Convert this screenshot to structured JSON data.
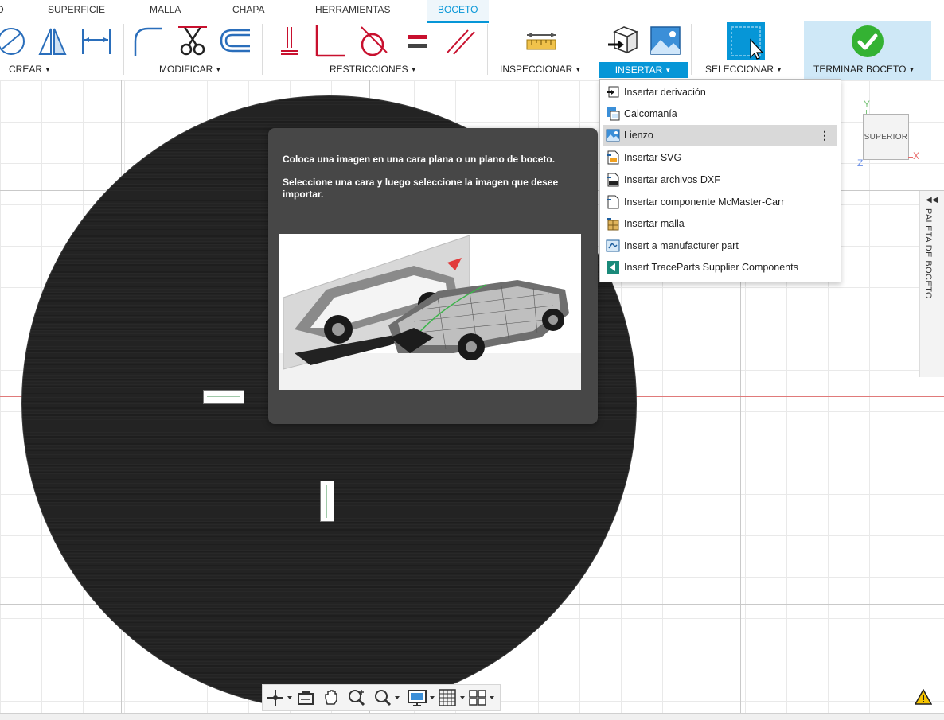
{
  "tabs": [
    {
      "label": "D"
    },
    {
      "label": "SUPERFICIE"
    },
    {
      "label": "MALLA"
    },
    {
      "label": "CHAPA"
    },
    {
      "label": "HERRAMIENTAS"
    },
    {
      "label": "BOCETO",
      "active": true
    }
  ],
  "groups": {
    "crear": "CREAR",
    "modificar": "MODIFICAR",
    "restricciones": "RESTRICCIONES",
    "inspeccionar": "INSPECCIONAR",
    "insertar": "INSERTAR",
    "seleccionar": "SELECCIONAR",
    "terminar": "TERMINAR BOCETO"
  },
  "insert_menu": {
    "items": [
      {
        "label": "Insertar derivación",
        "icon": "derive-icon"
      },
      {
        "label": "Calcomanía",
        "icon": "decal-icon"
      },
      {
        "label": "Lienzo",
        "icon": "canvas-image-icon",
        "highlighted": true,
        "more": "⋮"
      },
      {
        "label": "Insertar SVG",
        "icon": "svg-file-icon"
      },
      {
        "label": "Insertar archivos DXF",
        "icon": "dxf-file-icon"
      },
      {
        "label": "Insertar componente McMaster-Carr",
        "icon": "mcmaster-icon"
      },
      {
        "label": "Insertar malla",
        "icon": "mesh-icon"
      },
      {
        "label": "Insert a manufacturer part",
        "icon": "manufacturer-part-icon"
      },
      {
        "label": "Insert TraceParts Supplier Components",
        "icon": "traceparts-icon"
      }
    ]
  },
  "tooltip": {
    "line1": "Coloca una imagen en una cara plana o un plano de boceto.",
    "line2": "Seleccione una cara y luego seleccione la imagen que desee importar."
  },
  "viewcube": {
    "face": "SUPERIOR",
    "axis_y": "Y",
    "axis_x": "X",
    "axis_z": "Z"
  },
  "palette": {
    "label": "PALETA DE BOCETO"
  },
  "colors": {
    "accent": "#0696d7",
    "finish_green": "#34b233",
    "constraint_red": "#c8102e"
  }
}
